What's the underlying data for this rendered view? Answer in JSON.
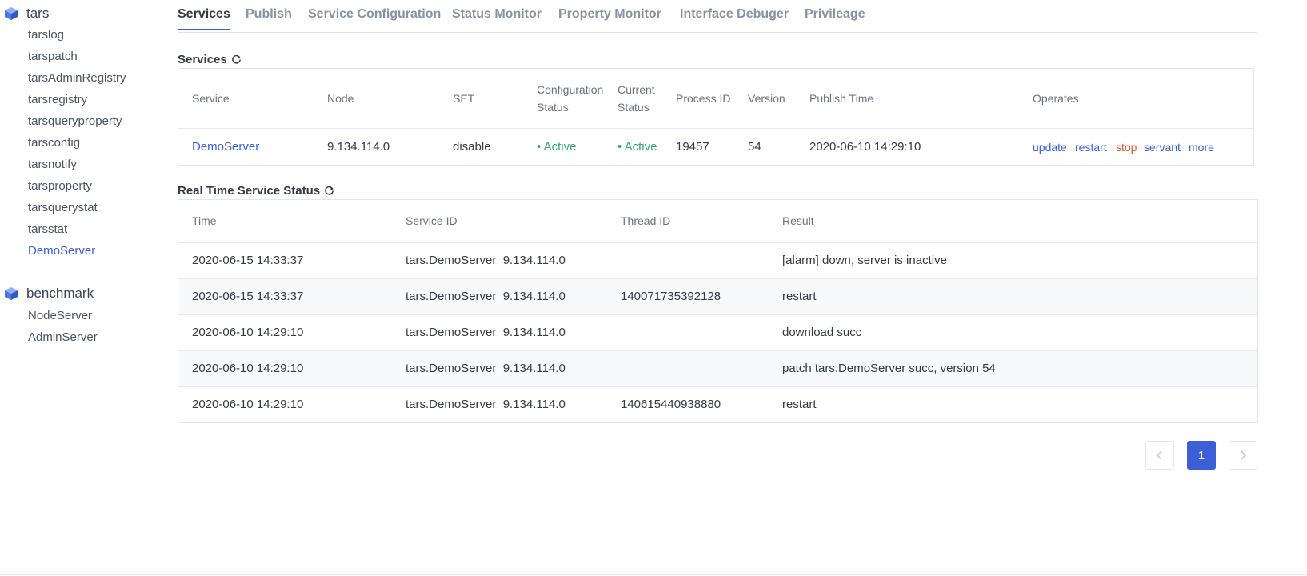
{
  "sidebar": {
    "groups": [
      {
        "title": "tars",
        "items": [
          "tarslog",
          "tarspatch",
          "tarsAdminRegistry",
          "tarsregistry",
          "tarsqueryproperty",
          "tarsconfig",
          "tarsnotify",
          "tarsproperty",
          "tarsquerystat",
          "tarsstat",
          "DemoServer"
        ]
      },
      {
        "title": "benchmark",
        "items": [
          "NodeServer",
          "AdminServer"
        ]
      }
    ],
    "active_item": "DemoServer"
  },
  "tabs": [
    "Services",
    "Publish",
    "Service Configuration",
    "Status Monitor",
    "Property Monitor",
    "Interface Debuger",
    "Privileage"
  ],
  "active_tab": "Services",
  "services": {
    "title": "Services",
    "headers": [
      "Service",
      "Node",
      "SET",
      "Configuration Status",
      "Current Status",
      "Process ID",
      "Version",
      "Publish Time",
      "Operates"
    ],
    "header_lines": {
      "config_status": [
        "Configuration",
        "Status"
      ],
      "current_status": [
        "Current",
        "Status"
      ]
    },
    "row": {
      "service": "DemoServer",
      "node": "9.134.114.0",
      "set": "disable",
      "config_status": "• Active",
      "current_status": "• Active",
      "process_id": "19457",
      "version": "54",
      "publish_time": "2020-06-10 14:29:10",
      "operates": [
        "update",
        "restart",
        "stop",
        "servant",
        "more"
      ]
    }
  },
  "realtime": {
    "title": "Real Time Service Status",
    "headers": [
      "Time",
      "Service ID",
      "Thread ID",
      "Result"
    ],
    "rows": [
      {
        "time": "2020-06-15 14:33:37",
        "service_id": "tars.DemoServer_9.134.114.0",
        "thread_id": "",
        "result": "[alarm] down, server is inactive"
      },
      {
        "time": "2020-06-15 14:33:37",
        "service_id": "tars.DemoServer_9.134.114.0",
        "thread_id": "140071735392128",
        "result": "restart"
      },
      {
        "time": "2020-06-10 14:29:10",
        "service_id": "tars.DemoServer_9.134.114.0",
        "thread_id": "",
        "result": "download succ"
      },
      {
        "time": "2020-06-10 14:29:10",
        "service_id": "tars.DemoServer_9.134.114.0",
        "thread_id": "",
        "result": "patch tars.DemoServer succ, version 54"
      },
      {
        "time": "2020-06-10 14:29:10",
        "service_id": "tars.DemoServer_9.134.114.0",
        "thread_id": "140615440938880",
        "result": "restart"
      }
    ]
  },
  "pagination": {
    "current_page": "1",
    "prev_icon": "chevron-left-icon",
    "next_icon": "chevron-right-icon"
  },
  "colors": {
    "accent": "#3d5fd6",
    "active_status": "#3aa17e",
    "danger": "#d0563c"
  }
}
